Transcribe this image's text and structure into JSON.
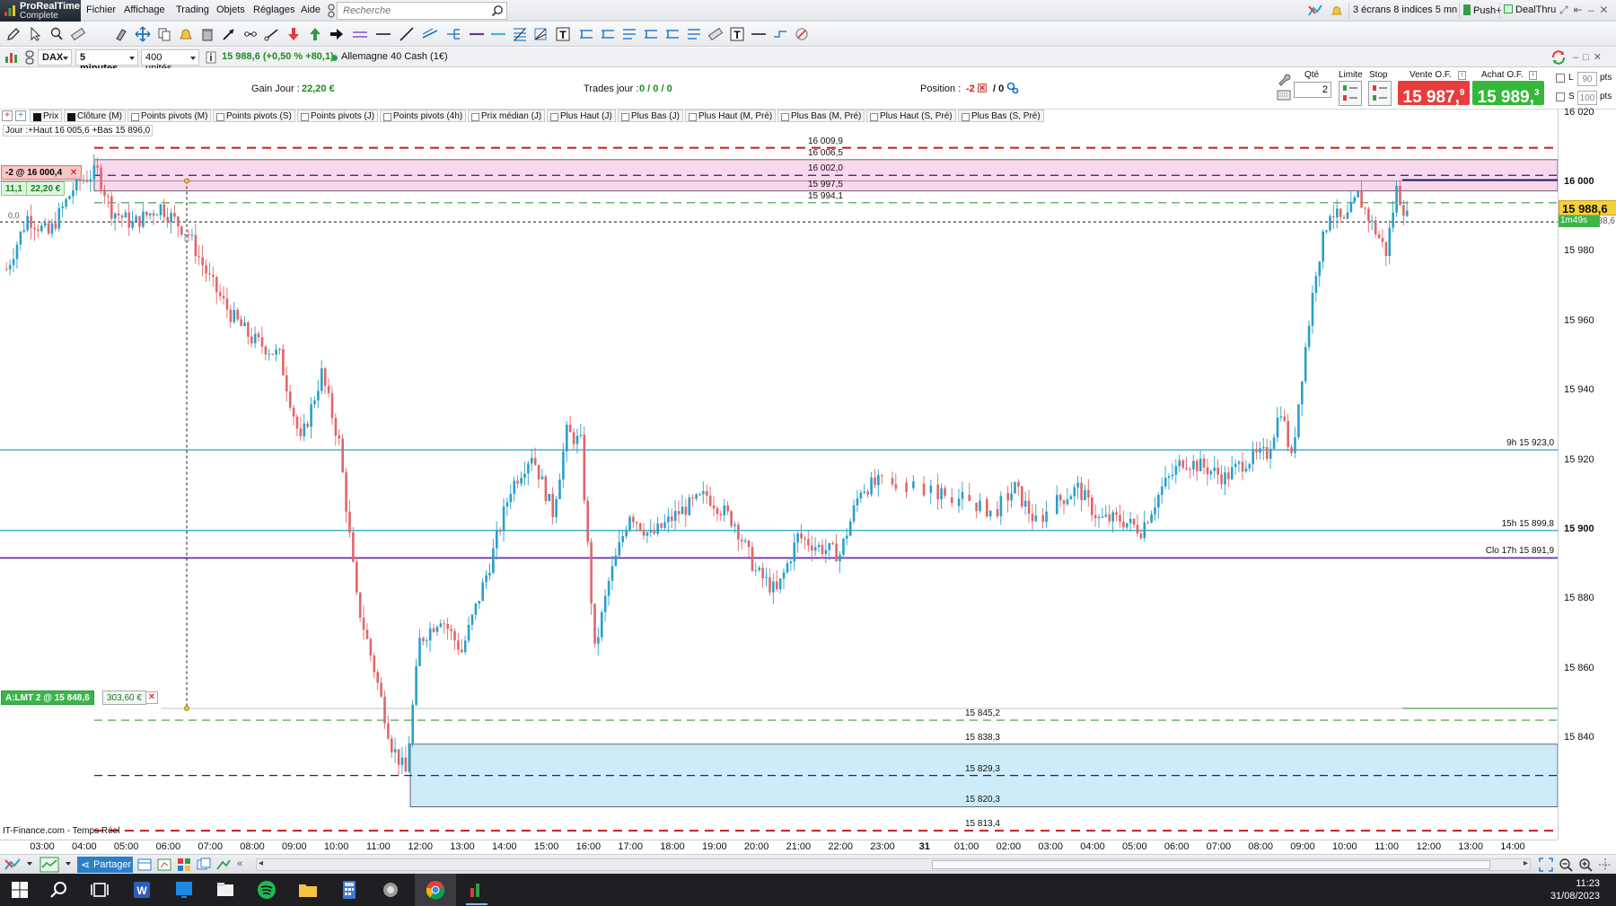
{
  "app": {
    "logo_line1": "ProRealTime",
    "logo_line2": "Complete"
  },
  "menu": [
    "Fichier",
    "Affichage",
    "Trading",
    "Objets",
    "Réglages",
    "Aide"
  ],
  "search": {
    "placeholder": "Recherche"
  },
  "right_menu": {
    "screens": "3 écrans 8 indices 5 mn",
    "push": "Push+",
    "dealthru": "DealThru"
  },
  "instrument": {
    "symbol": "DAX",
    "timeframe": "5 minutes",
    "units": "400 unités",
    "quote": "15 988,6 (+0,50 % +80,1)",
    "name": "Allemagne 40 Cash (1€)"
  },
  "summary": {
    "gain_label": "Gain Jour :",
    "gain_value": "22,20 €",
    "trades_label": "Trades jour :",
    "trades_value": "0 / 0 / 0",
    "position_label": "Position :",
    "position_value": "-2",
    "position_extra": "/ 0"
  },
  "order_panel": {
    "qty_label": "Qté",
    "qty_value": "2",
    "limit_label": "Limite",
    "stop_label": "Stop",
    "sell_label": "Vente O.F.",
    "buy_label": "Achat O.F.",
    "sell_price": "15 987,",
    "sell_price_sup": "9",
    "buy_price": "15 989,",
    "buy_price_sup": "3",
    "l_label": "L",
    "s_label": "S",
    "l_pts": "90",
    "s_pts": "100",
    "pts_unit": "pts"
  },
  "indicators": [
    {
      "label": "Prix",
      "checked": true
    },
    {
      "label": "Clôture (M)",
      "checked": true
    },
    {
      "label": "Points pivots (M)",
      "checked": false
    },
    {
      "label": "Points pivots (S)",
      "checked": false
    },
    {
      "label": "Points pivots (J)",
      "checked": false
    },
    {
      "label": "Points pivots (4h)",
      "checked": false
    },
    {
      "label": "Prix médian (J)",
      "checked": false
    },
    {
      "label": "Plus Haut (J)",
      "checked": false
    },
    {
      "label": "Plus Bas (J)",
      "checked": false
    },
    {
      "label": "Plus Haut (M, Pré)",
      "checked": false
    },
    {
      "label": "Plus Bas (M, Pré)",
      "checked": false
    },
    {
      "label": "Plus Haut (S, Pré)",
      "checked": false
    },
    {
      "label": "Plus Bas (S, Pré)",
      "checked": false
    }
  ],
  "chart_texts": {
    "day_info": "Jour :+Haut 16 005,6 +Bas 15 896,0",
    "order_short": "-2 @ 16 000,4",
    "order_short_sub1": "11,1",
    "order_short_sub2": "22,20 €",
    "order_limit": "A:LMT  2 @ 15 848,6",
    "order_limit_value": "303,60 €",
    "source": "IT-Finance.com - Temps Réel",
    "price_tag": "15 988,6",
    "countdown": "1m49s",
    "gap_label": "15 988,6",
    "stub_label": "0,0"
  },
  "levels": [
    {
      "label": "16 009,9",
      "value": 16009.9,
      "style": "red-dash"
    },
    {
      "label": "16 006,5",
      "value": 16006.5,
      "style": "pink-top"
    },
    {
      "label": "16 002,0",
      "value": 16002.0,
      "style": "blue-dash"
    },
    {
      "label": "15 997,5",
      "value": 15997.5,
      "style": "pink-bottom"
    },
    {
      "label": "15 994,1",
      "value": 15994.1,
      "style": "green-dash"
    },
    {
      "label": "15 845,2",
      "value": 15845.2,
      "style": "green-dash"
    },
    {
      "label": "15 838,3",
      "value": 15838.3,
      "style": "blue-top"
    },
    {
      "label": "15 829,3",
      "value": 15829.3,
      "style": "blue-dash"
    },
    {
      "label": "15 820,3",
      "value": 15820.3,
      "style": "blue-bottom"
    },
    {
      "label": "15 813,4",
      "value": 15813.4,
      "style": "red-dash"
    }
  ],
  "ref_lines": [
    {
      "label": "9h 15 923,0",
      "value": 15923.0,
      "color": "#3fb6d8"
    },
    {
      "label": "15h 15 899,8",
      "value": 15899.8,
      "color": "#3fb6d8"
    },
    {
      "label": "Clo 17h 15 891,9",
      "value": 15891.9,
      "color": "#6a2fa8"
    }
  ],
  "chart_data": {
    "type": "candlestick",
    "instrument": "DAX",
    "timeframe": "5 minutes",
    "ylim": [
      15813,
      16020
    ],
    "yticks": [
      "16 020",
      "16 000",
      "15 980",
      "15 960",
      "15 940",
      "15 920",
      "15 900",
      "15 880",
      "15 860",
      "15 840"
    ],
    "ytick_values": [
      16020,
      16000,
      15980,
      15960,
      15940,
      15920,
      15900,
      15880,
      15860,
      15840
    ],
    "xticks": [
      "03:00",
      "04:00",
      "05:00",
      "06:00",
      "07:00",
      "08:00",
      "09:00",
      "10:00",
      "11:00",
      "12:00",
      "13:00",
      "14:00",
      "15:00",
      "16:00",
      "17:00",
      "18:00",
      "19:00",
      "20:00",
      "21:00",
      "22:00",
      "23:00",
      "31",
      "01:00",
      "02:00",
      "03:00",
      "04:00",
      "05:00",
      "06:00",
      "07:00",
      "08:00",
      "09:00",
      "10:00",
      "11:00",
      "12:00",
      "13:00",
      "14:00"
    ],
    "price_path_knots": [
      [
        0,
        15975
      ],
      [
        6,
        15990
      ],
      [
        12,
        15985
      ],
      [
        20,
        16000
      ],
      [
        26,
        16003
      ],
      [
        30,
        15992
      ],
      [
        36,
        15988
      ],
      [
        44,
        15993
      ],
      [
        52,
        15985
      ],
      [
        58,
        15972
      ],
      [
        64,
        15962
      ],
      [
        70,
        15955
      ],
      [
        78,
        15950
      ],
      [
        84,
        15925
      ],
      [
        90,
        15945
      ],
      [
        95,
        15925
      ],
      [
        100,
        15880
      ],
      [
        105,
        15860
      ],
      [
        110,
        15838
      ],
      [
        114,
        15830
      ],
      [
        118,
        15868
      ],
      [
        124,
        15875
      ],
      [
        130,
        15865
      ],
      [
        138,
        15890
      ],
      [
        144,
        15912
      ],
      [
        150,
        15922
      ],
      [
        156,
        15905
      ],
      [
        160,
        15928
      ],
      [
        164,
        15925
      ],
      [
        168,
        15865
      ],
      [
        172,
        15885
      ],
      [
        178,
        15905
      ],
      [
        184,
        15898
      ],
      [
        192,
        15905
      ],
      [
        200,
        15910
      ],
      [
        208,
        15902
      ],
      [
        214,
        15888
      ],
      [
        220,
        15882
      ],
      [
        226,
        15898
      ],
      [
        232,
        15895
      ],
      [
        238,
        15893
      ],
      [
        244,
        15912
      ],
      [
        252,
        15914
      ],
      [
        260,
        15913
      ],
      [
        268,
        15910
      ],
      [
        276,
        15908
      ],
      [
        282,
        15905
      ],
      [
        288,
        15912
      ],
      [
        294,
        15902
      ],
      [
        300,
        15908
      ],
      [
        306,
        15912
      ],
      [
        312,
        15903
      ],
      [
        318,
        15903
      ],
      [
        324,
        15900
      ],
      [
        330,
        15912
      ],
      [
        336,
        15920
      ],
      [
        342,
        15918
      ],
      [
        348,
        15915
      ],
      [
        354,
        15920
      ],
      [
        360,
        15922
      ],
      [
        364,
        15935
      ],
      [
        367,
        15920
      ],
      [
        370,
        15945
      ],
      [
        374,
        15975
      ],
      [
        378,
        15992
      ],
      [
        382,
        15988
      ],
      [
        386,
        15996
      ],
      [
        390,
        15988
      ],
      [
        394,
        15980
      ],
      [
        397,
        15998
      ],
      [
        400,
        15990
      ]
    ]
  },
  "taskbar": {
    "time": "11:23",
    "date": "31/08/2023"
  },
  "colors": {
    "bull": "#2a9fc9",
    "bear": "#e0666a",
    "pink_zone": "#f8cbe6",
    "blue_zone": "#c5e8f8",
    "red_dash": "#d01818",
    "green_dash": "#3c9a3c",
    "navy_dash": "#1a237e",
    "sell_red": "#e63d3d",
    "buy_green": "#34b73a"
  }
}
